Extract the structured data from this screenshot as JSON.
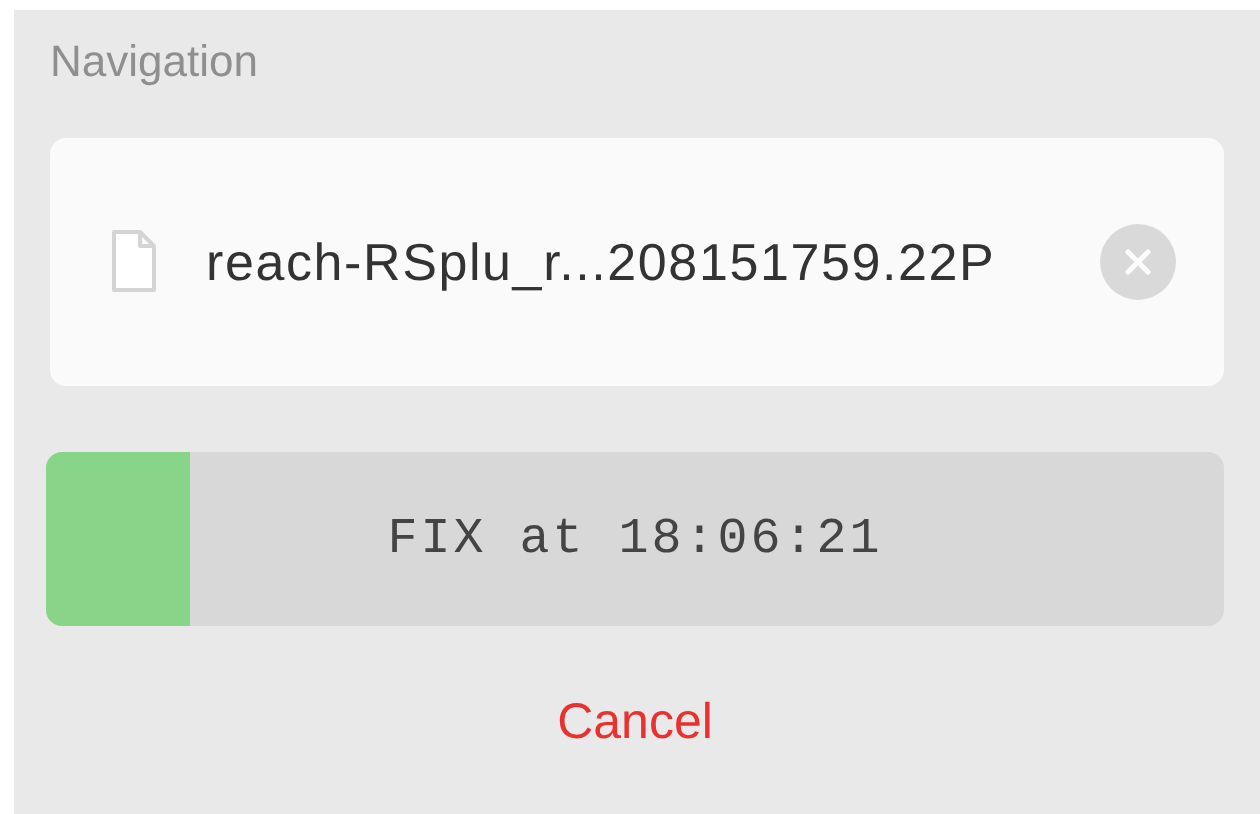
{
  "section_title": "Navigation",
  "file": {
    "name": "reach-RSplu_r...208151759.22P"
  },
  "progress": {
    "level": 0.122,
    "label": "FIX at 18:06:21"
  },
  "cancel_button": {
    "label": "Cancel"
  }
}
